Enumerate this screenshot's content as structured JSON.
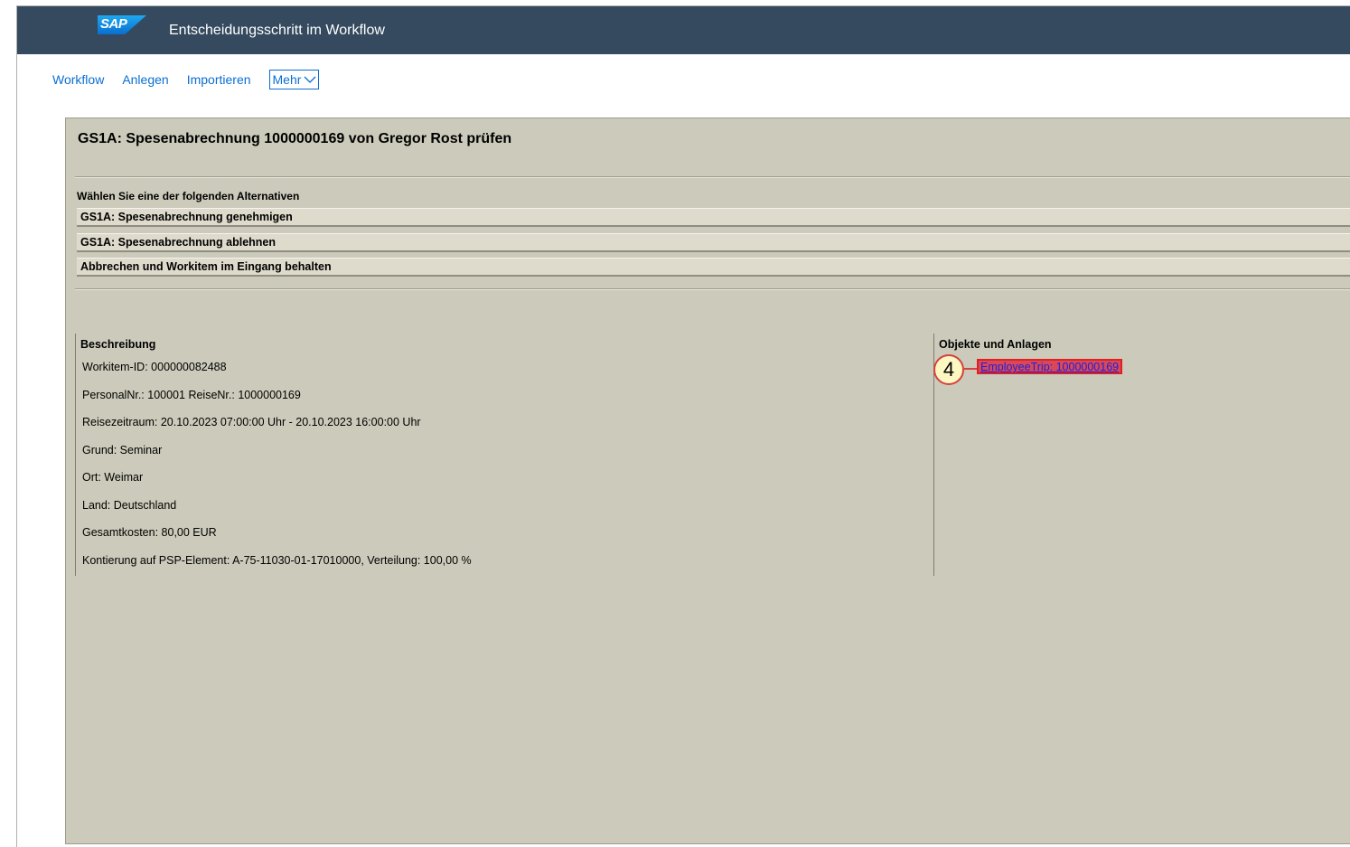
{
  "shell": {
    "logo_text": "SAP",
    "title": "Entscheidungsschritt im Workflow"
  },
  "menu": {
    "items": [
      "Workflow",
      "Anlegen",
      "Importieren"
    ],
    "more_label": "Mehr"
  },
  "workitem": {
    "title": "GS1A: Spesenabrechnung 1000000169 von Gregor Rost prüfen"
  },
  "alternatives": {
    "label": "Wählen Sie eine der folgenden Alternativen",
    "options": [
      "GS1A: Spesenabrechnung genehmigen",
      "GS1A: Spesenabrechnung ablehnen",
      "Abbrechen und Workitem im Eingang behalten"
    ]
  },
  "description": {
    "header": "Beschreibung",
    "lines": [
      "Workitem-ID: 000000082488",
      "PersonalNr.: 100001 ReiseNr.: 1000000169",
      "Reisezeitraum: 20.10.2023 07:00:00 Uhr - 20.10.2023 16:00:00 Uhr",
      "Grund: Seminar",
      "Ort: Weimar",
      "Land: Deutschland",
      "Gesamtkosten: 80,00 EUR",
      "Kontierung auf PSP-Element: A-75-11030-01-17010000, Verteilung: 100,00 %"
    ]
  },
  "objects": {
    "header": "Objekte und Anlagen",
    "link": "EmployeeTrip: 1000000169",
    "callout_number": "4"
  },
  "colors": {
    "shell_bg": "#354a5f",
    "content_bg": "#cccbbb",
    "link_blue": "#0a6ed1",
    "highlight_red": "#e02020"
  }
}
